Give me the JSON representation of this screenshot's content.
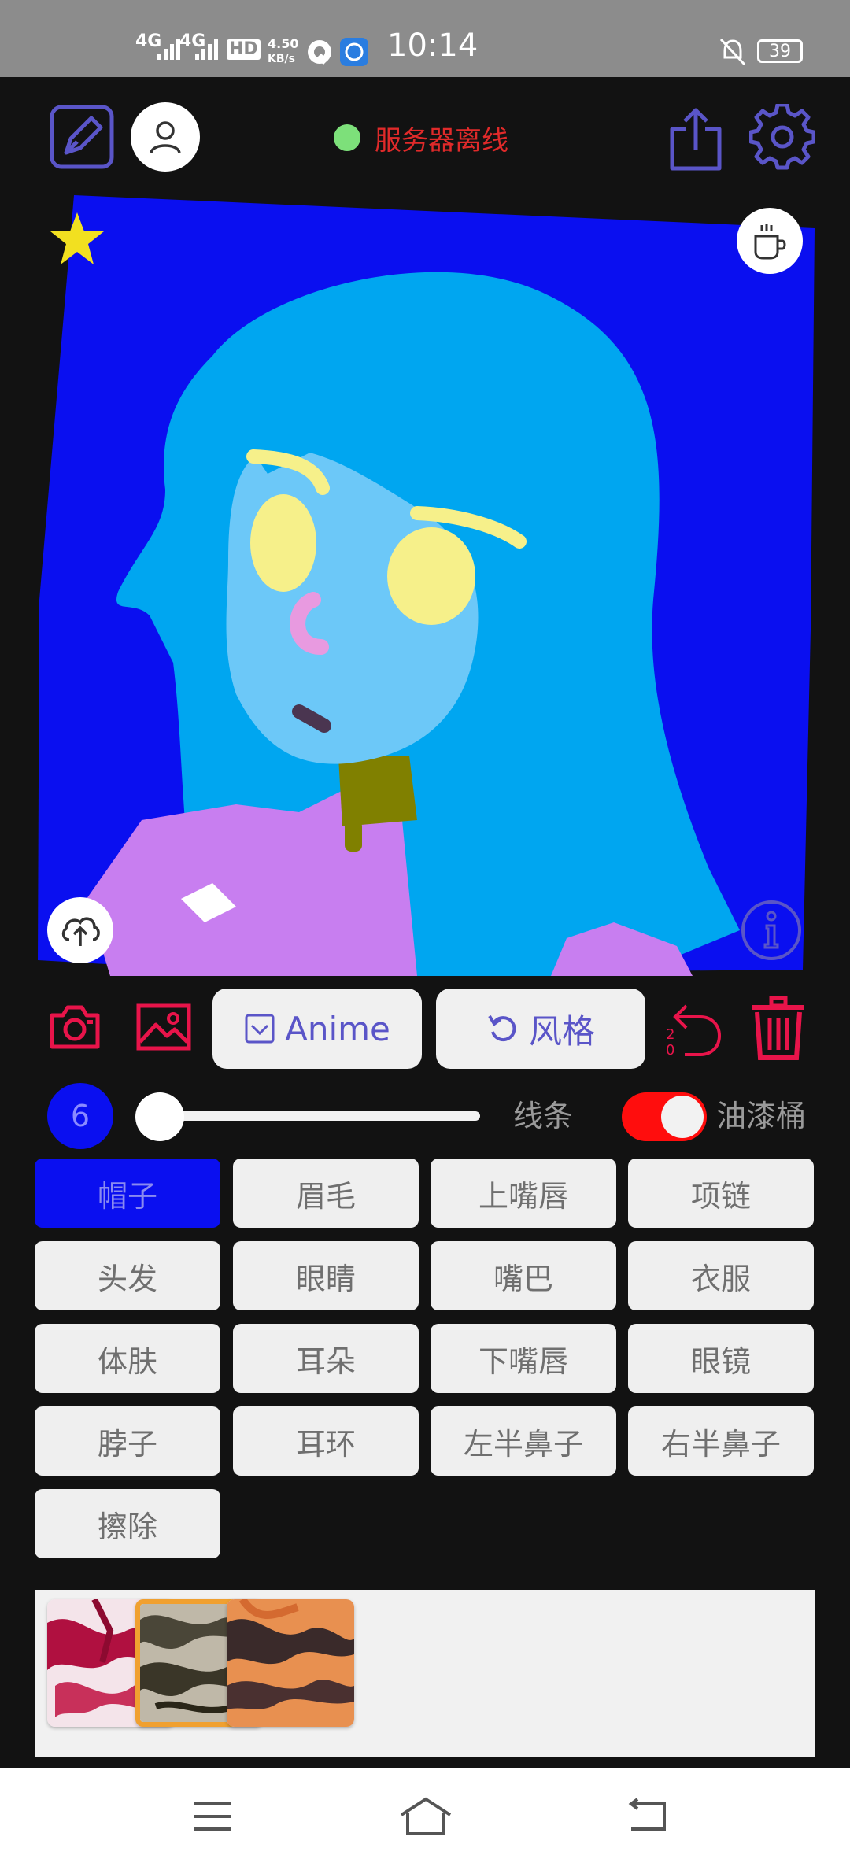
{
  "status_bar": {
    "net1": "4G",
    "net2": "4G",
    "hd": "HD",
    "speed_value": "4.50",
    "speed_unit": "KB/s",
    "time": "10:14",
    "battery": "39"
  },
  "header": {
    "server_status": "服务器离线"
  },
  "toolbar": {
    "anime_label": "Anime",
    "style_label": "风格"
  },
  "brush": {
    "size": "6",
    "size_slider_fraction": 0.0,
    "line_label": "线条",
    "bucket_label": "油漆桶",
    "bucket_on": true
  },
  "parts": [
    {
      "label": "帽子",
      "selected": true
    },
    {
      "label": "眉毛",
      "selected": false
    },
    {
      "label": "上嘴唇",
      "selected": false
    },
    {
      "label": "项链",
      "selected": false
    },
    {
      "label": "头发",
      "selected": false
    },
    {
      "label": "眼睛",
      "selected": false
    },
    {
      "label": "嘴巴",
      "selected": false
    },
    {
      "label": "衣服",
      "selected": false
    },
    {
      "label": "体肤",
      "selected": false
    },
    {
      "label": "耳朵",
      "selected": false
    },
    {
      "label": "下嘴唇",
      "selected": false
    },
    {
      "label": "眼镜",
      "selected": false
    },
    {
      "label": "脖子",
      "selected": false
    },
    {
      "label": "耳环",
      "selected": false
    },
    {
      "label": "左半鼻子",
      "selected": false
    },
    {
      "label": "右半鼻子",
      "selected": false
    },
    {
      "label": "擦除",
      "selected": false
    }
  ],
  "colors": {
    "accent_red": "#e8144a",
    "accent_purple": "#5a55c8",
    "selected_blue": "#0a0ff0",
    "canvas_bg": "#0a0ff0",
    "hair": "#00a6f0",
    "skin": "#6cc8f8",
    "eyes": "#f6f08a",
    "clothes": "#c87ef0"
  }
}
